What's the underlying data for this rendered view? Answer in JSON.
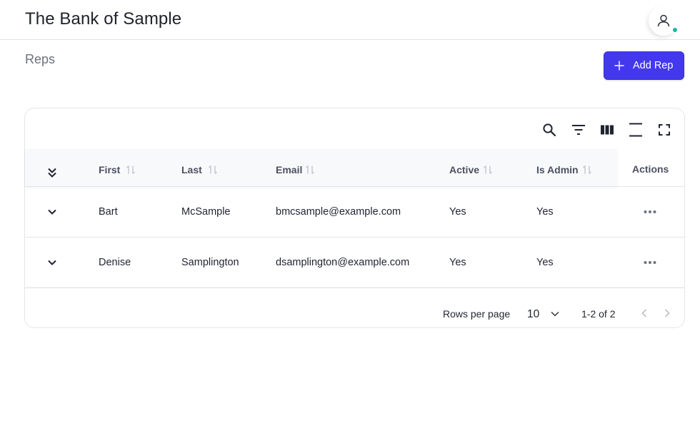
{
  "app": {
    "title": "The Bank of Sample"
  },
  "user": {
    "avatar_icon": "user-icon",
    "status_color": "#14b8a6"
  },
  "page": {
    "title": "Reps"
  },
  "actions": {
    "add_label": "Add Rep",
    "accent": "#4338ee"
  },
  "toolbar": [
    "search-icon",
    "filter-icon",
    "columns-icon",
    "density-icon",
    "fullscreen-icon"
  ],
  "table": {
    "columns": {
      "first": "First",
      "last": "Last",
      "email": "Email",
      "active": "Active",
      "is_admin": "Is Admin",
      "actions": "Actions"
    },
    "rows": [
      {
        "first": "Bart",
        "last": "McSample",
        "email": "bmcsample@example.com",
        "active": "Yes",
        "is_admin": "Yes"
      },
      {
        "first": "Denise",
        "last": "Samplington",
        "email": "dsamplington@example.com",
        "active": "Yes",
        "is_admin": "Yes"
      }
    ]
  },
  "pagination": {
    "rows_per_page_label": "Rows per page",
    "rows_per_page_value": "10",
    "range": "1-2 of 2"
  }
}
